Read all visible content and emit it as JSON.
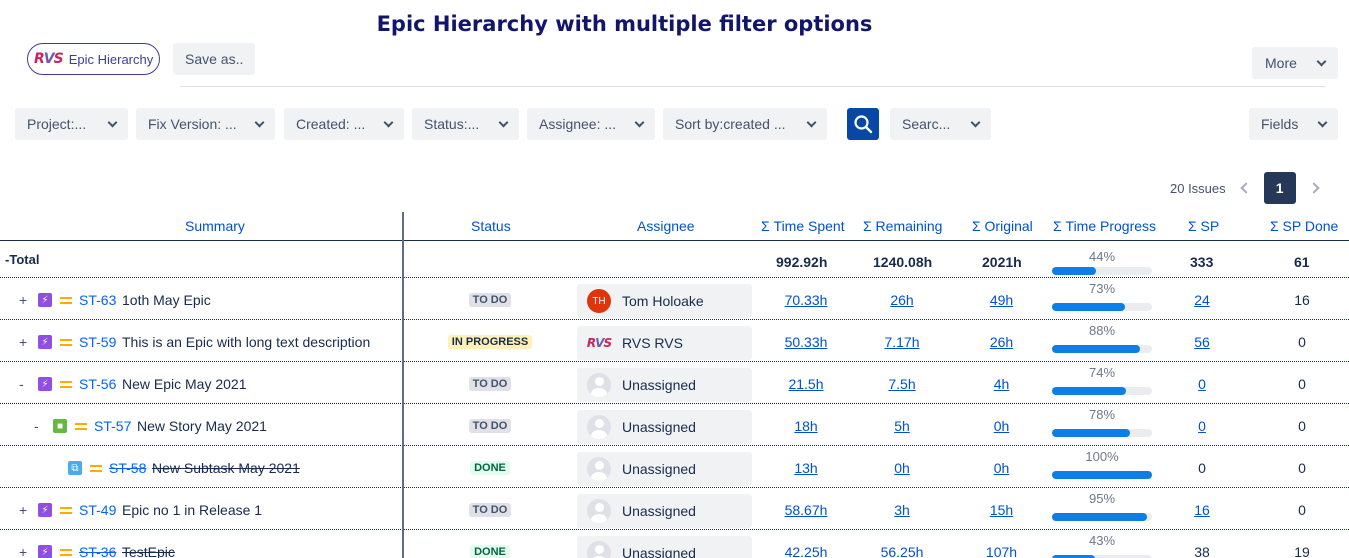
{
  "headline": "Epic Hierarchy with multiple filter options",
  "toolbar": {
    "view_name": "Epic Hierarchy",
    "save_as": "Save as..",
    "more": "More"
  },
  "filters": {
    "project": "Project:...",
    "fix_version": "Fix Version: ...",
    "created": "Created: ...",
    "status": "Status:...",
    "assignee": "Assignee: ...",
    "sort_by": "Sort by:created ...",
    "search": "Searc...",
    "fields": "Fields"
  },
  "pager": {
    "issue_count": "20 Issues",
    "current_page": "1"
  },
  "columns": {
    "summary": "Summary",
    "status": "Status",
    "assignee": "Assignee",
    "time_spent": "Σ Time Spent",
    "remaining": "Σ Remaining",
    "original": "Σ Original",
    "time_progress": "Σ Time Progress",
    "sp": "Σ SP",
    "sp_done": "Σ SP Done"
  },
  "total": {
    "toggle": "-",
    "label": "Total",
    "time_spent": "992.92h",
    "remaining": "1240.08h",
    "original": "2021h",
    "progress_label": "44%",
    "progress": 0.44,
    "sp": "333",
    "sp_done": "61"
  },
  "rows": [
    {
      "toggle": "+",
      "type": "epic",
      "key": "ST-63",
      "summary": "1oth May Epic",
      "done": false,
      "status": "TO DO",
      "assignee": "Tom Holoake",
      "avatar": "TH",
      "avatar_type": "initials",
      "time_spent": "70.33h",
      "remaining": "26h",
      "original": "49h",
      "progress_label": "73%",
      "progress": 0.73,
      "sp": "24",
      "sp_link": true,
      "sp_done": "16"
    },
    {
      "toggle": "+",
      "type": "epic",
      "key": "ST-59",
      "summary": "This is an Epic with long text description",
      "done": false,
      "status": "IN PROGRESS",
      "assignee": "RVS RVS",
      "avatar": "",
      "avatar_type": "rvs",
      "time_spent": "50.33h",
      "remaining": "7.17h",
      "original": "26h",
      "progress_label": "88%",
      "progress": 0.88,
      "sp": "56",
      "sp_link": true,
      "sp_done": "0"
    },
    {
      "toggle": "-",
      "type": "epic",
      "key": "ST-56",
      "summary": "New Epic May 2021",
      "done": false,
      "status": "TO DO",
      "assignee": "Unassigned",
      "avatar": "",
      "avatar_type": "unassigned",
      "time_spent": "21.5h",
      "remaining": "7.5h",
      "original": "4h",
      "progress_label": "74%",
      "progress": 0.74,
      "sp": "0",
      "sp_link": true,
      "sp_done": "0"
    },
    {
      "toggle": "-",
      "type": "story",
      "key": "ST-57",
      "summary": "New Story May 2021",
      "done": false,
      "status": "TO DO",
      "assignee": "Unassigned",
      "avatar": "",
      "avatar_type": "unassigned",
      "time_spent": "18h",
      "remaining": "5h",
      "original": "0h",
      "progress_label": "78%",
      "progress": 0.78,
      "sp": "0",
      "sp_link": true,
      "sp_done": "0"
    },
    {
      "toggle": "",
      "type": "subtask",
      "key": "ST-58",
      "summary": "New Subtask May 2021",
      "done": true,
      "status": "DONE",
      "assignee": "Unassigned",
      "avatar": "",
      "avatar_type": "unassigned",
      "time_spent": "13h",
      "remaining": "0h",
      "original": "0h",
      "progress_label": "100%",
      "progress": 1.0,
      "sp": "0",
      "sp_link": false,
      "sp_done": "0"
    },
    {
      "toggle": "+",
      "type": "epic",
      "key": "ST-49",
      "summary": "Epic no 1 in Release 1",
      "done": false,
      "status": "TO DO",
      "assignee": "Unassigned",
      "avatar": "",
      "avatar_type": "unassigned",
      "time_spent": "58.67h",
      "remaining": "3h",
      "original": "15h",
      "progress_label": "95%",
      "progress": 0.95,
      "sp": "16",
      "sp_link": true,
      "sp_done": "0"
    },
    {
      "toggle": "+",
      "type": "epic",
      "key": "ST-36",
      "summary": "TestEpic",
      "done": true,
      "status": "DONE",
      "assignee": "Unassigned",
      "avatar": "",
      "avatar_type": "unassigned",
      "time_spent": "42.25h",
      "remaining": "56.25h",
      "original": "107h",
      "progress_label": "43%",
      "progress": 0.43,
      "sp": "38",
      "sp_link": false,
      "sp_done": "19"
    }
  ],
  "colors": {
    "headline": "#12166b",
    "link": "#0052cc",
    "epic": "#904ee2",
    "story": "#63ba3c",
    "subtask": "#4bade8",
    "priority": "#ffab00",
    "progress": "#0c7ee6",
    "todo_bg": "#dfe1e6",
    "todo_fg": "#42526e",
    "inprogress_bg": "#fff0b3",
    "inprogress_fg": "#172b4d",
    "done_bg": "#e3fcef",
    "done_fg": "#006644",
    "avatar_th": "#de350b"
  }
}
